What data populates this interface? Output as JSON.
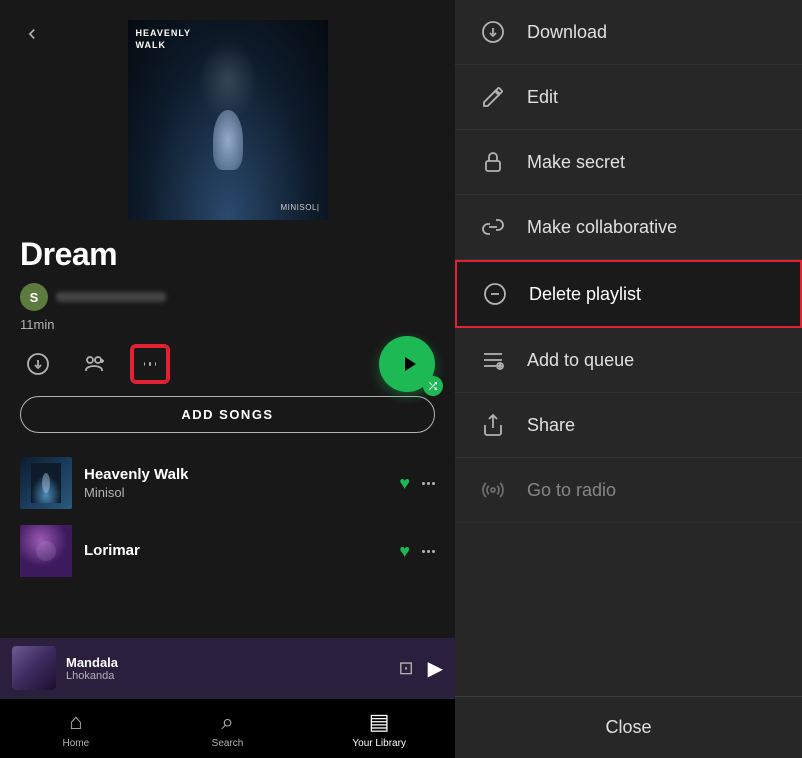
{
  "left": {
    "back_label": "Back",
    "album": {
      "title_line1": "HEAVENLY",
      "title_line2": "WALK",
      "artist_label": "MINISOL|"
    },
    "playlist": {
      "title": "Dream",
      "avatar_initial": "S",
      "duration": "11min"
    },
    "controls": {
      "more_dots_highlight": true
    },
    "add_songs_label": "ADD SONGS",
    "tracks": [
      {
        "name": "Heavenly Walk",
        "artist": "Minisol",
        "liked": true
      },
      {
        "name": "Lorimar",
        "artist": "",
        "liked": true
      }
    ],
    "now_playing": {
      "title": "Mandala",
      "artist": "Lhokanda"
    },
    "nav": [
      {
        "label": "Home",
        "icon": "home",
        "active": false
      },
      {
        "label": "Search",
        "icon": "search",
        "active": false
      },
      {
        "label": "Your Library",
        "icon": "library",
        "active": true
      }
    ]
  },
  "menu": {
    "items": [
      {
        "id": "download",
        "label": "Download",
        "icon": "download"
      },
      {
        "id": "edit",
        "label": "Edit",
        "icon": "edit"
      },
      {
        "id": "make-secret",
        "label": "Make secret",
        "icon": "lock"
      },
      {
        "id": "make-collaborative",
        "label": "Make collaborative",
        "icon": "music-note"
      },
      {
        "id": "delete-playlist",
        "label": "Delete playlist",
        "icon": "minus-circle",
        "highlighted": true
      },
      {
        "id": "add-to-queue",
        "label": "Add to queue",
        "icon": "add-queue"
      },
      {
        "id": "share",
        "label": "Share",
        "icon": "share"
      },
      {
        "id": "go-to-radio",
        "label": "Go to radio",
        "icon": "radio"
      }
    ],
    "close_label": "Close"
  }
}
